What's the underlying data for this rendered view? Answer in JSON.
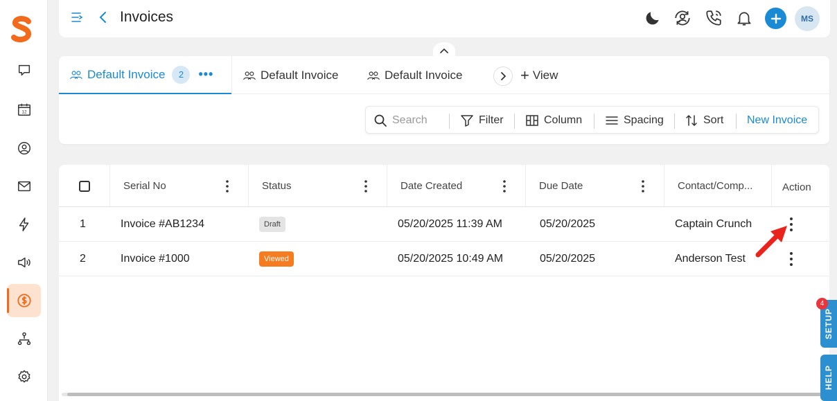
{
  "header": {
    "title": "Invoices",
    "avatar_initials": "MS"
  },
  "sidebar": {
    "items": [
      {
        "name": "conversations-icon"
      },
      {
        "name": "calendar-icon",
        "day": "12"
      },
      {
        "name": "contacts-icon"
      },
      {
        "name": "email-icon"
      },
      {
        "name": "automation-icon"
      },
      {
        "name": "marketing-icon"
      },
      {
        "name": "payments-icon",
        "active": true
      },
      {
        "name": "workflow-icon"
      },
      {
        "name": "settings-icon"
      }
    ]
  },
  "tabs": [
    {
      "label": "Default Invoice",
      "count": "2",
      "more": "•••",
      "active": true
    },
    {
      "label": "Default Invoice"
    },
    {
      "label": "Default Invoice"
    }
  ],
  "add_view_label": "View",
  "toolbar": {
    "search_placeholder": "Search",
    "filter_label": "Filter",
    "column_label": "Column",
    "spacing_label": "Spacing",
    "sort_label": "Sort",
    "new_invoice_label": "New Invoice"
  },
  "table": {
    "columns": [
      "Serial No",
      "Status",
      "Date Created",
      "Due Date",
      "Contact/Comp...",
      "Action"
    ],
    "rows": [
      {
        "index": "1",
        "serial": "Invoice #AB1234",
        "status": "Draft",
        "date_created": "05/20/2025 11:39 AM",
        "due_date": "05/20/2025",
        "contact": "Captain Crunch"
      },
      {
        "index": "2",
        "serial": "Invoice #1000",
        "status": "Viewed",
        "date_created": "05/20/2025 10:49 AM",
        "due_date": "05/20/2025",
        "contact": "Anderson Test"
      }
    ]
  },
  "floating": {
    "setup_label": "SETUP",
    "setup_count": "4",
    "help_label": "HELP"
  },
  "colors": {
    "accent": "#1a8ad4",
    "brand": "#f26b1d",
    "viewed": "#f57c1f",
    "draft": "#e4e4e4",
    "annotation": "#e8241c"
  }
}
